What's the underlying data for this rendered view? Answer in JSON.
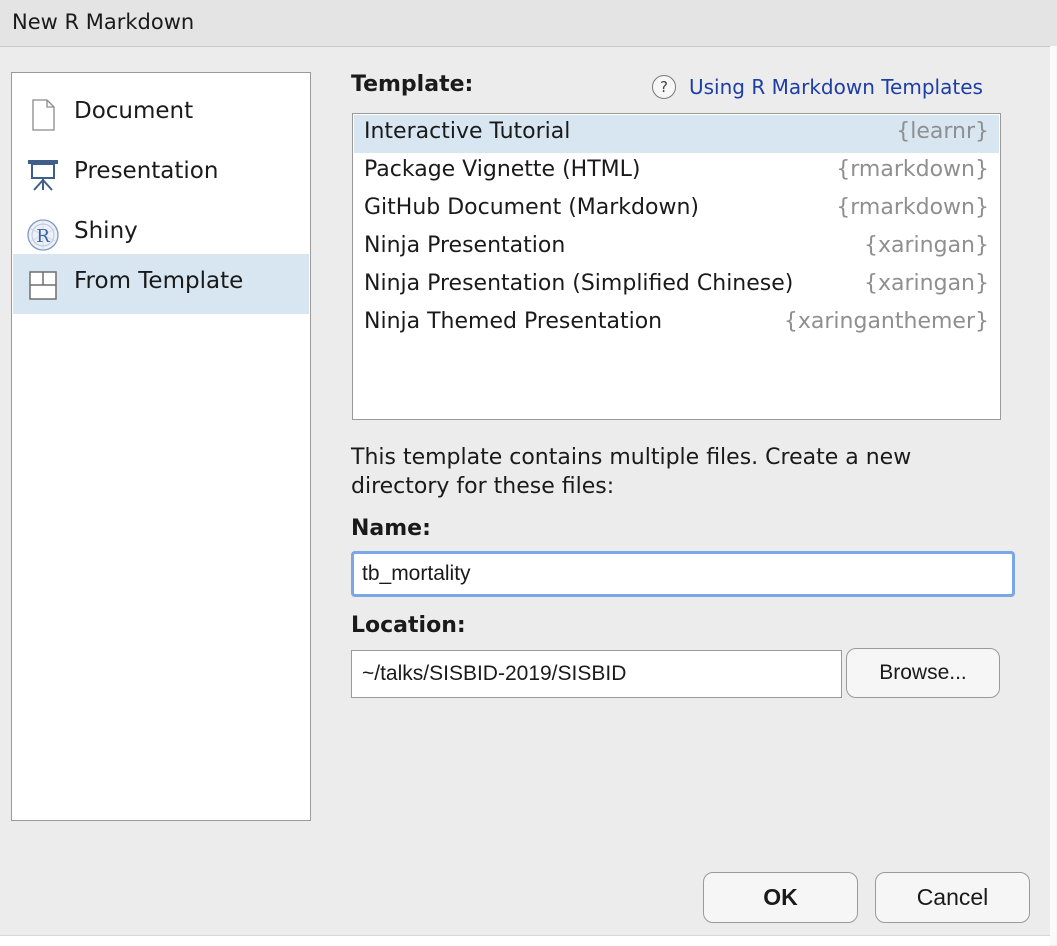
{
  "window": {
    "title": "New R Markdown"
  },
  "sidebar": {
    "items": [
      {
        "label": "Document",
        "icon": "document-icon"
      },
      {
        "label": "Presentation",
        "icon": "presentation-icon"
      },
      {
        "label": "Shiny",
        "icon": "shiny-icon"
      },
      {
        "label": "From Template",
        "icon": "template-icon",
        "selected": true
      }
    ]
  },
  "template": {
    "label": "Template:",
    "help_link": "Using R Markdown Templates",
    "help_icon": "?",
    "rows": [
      {
        "name": "Interactive Tutorial",
        "package": "{learnr}",
        "selected": true
      },
      {
        "name": "Package Vignette (HTML)",
        "package": "{rmarkdown}"
      },
      {
        "name": "GitHub Document (Markdown)",
        "package": "{rmarkdown}"
      },
      {
        "name": "Ninja Presentation",
        "package": "{xaringan}"
      },
      {
        "name": "Ninja Presentation (Simplified Chinese)",
        "package": "{xaringan}"
      },
      {
        "name": "Ninja Themed Presentation",
        "package": "{xaringanthemer}"
      }
    ]
  },
  "form": {
    "description": "This template contains multiple files. Create a new directory for these files:",
    "name_label": "Name:",
    "name_value": "tb_mortality",
    "location_label": "Location:",
    "location_value": "~/talks/SISBID-2019/SISBID",
    "browse_label": "Browse..."
  },
  "buttons": {
    "ok": "OK",
    "cancel": "Cancel"
  },
  "colors": {
    "selection": "#d8e6f2",
    "link": "#1d3ea3",
    "focus_ring": "#7aa7e6"
  }
}
